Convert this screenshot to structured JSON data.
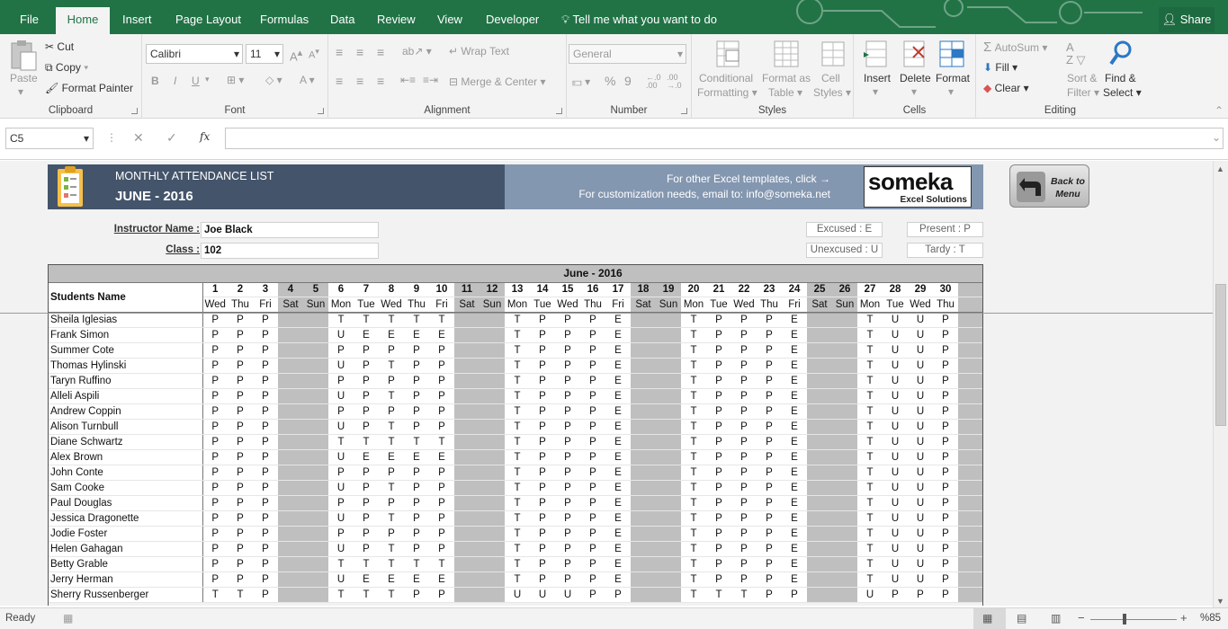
{
  "tabs": [
    {
      "label": "File"
    },
    {
      "label": "Home"
    },
    {
      "label": "Insert"
    },
    {
      "label": "Page Layout"
    },
    {
      "label": "Formulas"
    },
    {
      "label": "Data"
    },
    {
      "label": "Review"
    },
    {
      "label": "View"
    },
    {
      "label": "Developer"
    }
  ],
  "tell_me": "Tell me what you want to do",
  "share": "Share",
  "ribbon": {
    "clipboard": {
      "paste": "Paste",
      "cut": "Cut",
      "copy": "Copy",
      "format_painter": "Format Painter",
      "label": "Clipboard"
    },
    "font": {
      "name": "Calibri",
      "size": "11",
      "label": "Font",
      "bold": "B",
      "italic": "I",
      "underline": "U",
      "font_color": "A"
    },
    "alignment": {
      "wrap": "Wrap Text",
      "merge": "Merge & Center",
      "label": "Alignment"
    },
    "number": {
      "format": "General",
      "percent": "%",
      "comma": "9",
      "label": "Number"
    },
    "styles": {
      "cond1": "Conditional",
      "cond2": "Formatting",
      "fmt1": "Format as",
      "fmt2": "Table",
      "cell1": "Cell",
      "cell2": "Styles",
      "label": "Styles"
    },
    "cells": {
      "insert": "Insert",
      "delete": "Delete",
      "format": "Format",
      "label": "Cells"
    },
    "editing": {
      "autosum": "AutoSum",
      "fill": "Fill",
      "clear": "Clear",
      "sort1": "Sort &",
      "sort2": "Filter",
      "find1": "Find &",
      "find2": "Select",
      "label": "Editing"
    }
  },
  "formula_bar": {
    "name_box": "C5",
    "fx": "fx",
    "content": ""
  },
  "sheet": {
    "header_title": "MONTHLY ATTENDANCE LIST",
    "header_month": "JUNE - 2016",
    "promo_line1": "For other Excel templates, click →",
    "promo_line2": "For customization needs, email to: info@someka.net",
    "logo_text": "someka",
    "logo_sub": "Excel Solutions",
    "back_button": "Back to Menu",
    "instructor_label": "Instructor Name :",
    "instructor_value": "Joe Black",
    "class_label": "Class :",
    "class_value": "102",
    "legend": {
      "excused": "Excused : E",
      "present": "Present : P",
      "unexcused": "Unexcused : U",
      "tardy": "Tardy : T"
    },
    "table_title": "June - 2016",
    "students_header": "Students Name",
    "days": [
      "1",
      "2",
      "3",
      "4",
      "5",
      "6",
      "7",
      "8",
      "9",
      "10",
      "11",
      "12",
      "13",
      "14",
      "15",
      "16",
      "17",
      "18",
      "19",
      "20",
      "21",
      "22",
      "23",
      "24",
      "25",
      "26",
      "27",
      "28",
      "29",
      "30"
    ],
    "weekdays": [
      "Wed",
      "Thu",
      "Fri",
      "Sat",
      "Sun",
      "Mon",
      "Tue",
      "Wed",
      "Thu",
      "Fri",
      "Sat",
      "Sun",
      "Mon",
      "Tue",
      "Wed",
      "Thu",
      "Fri",
      "Sat",
      "Sun",
      "Mon",
      "Tue",
      "Wed",
      "Thu",
      "Fri",
      "Sat",
      "Sun",
      "Mon",
      "Tue",
      "Wed",
      "Thu"
    ],
    "weekend_cols": [
      4,
      5,
      11,
      12,
      18,
      19,
      25,
      26
    ],
    "students": [
      {
        "name": "Sheila Iglesias",
        "marks": [
          "P",
          "P",
          "P",
          "",
          "",
          "T",
          "T",
          "T",
          "T",
          "T",
          "",
          "",
          "T",
          "P",
          "P",
          "P",
          "E",
          "",
          "",
          "T",
          "P",
          "P",
          "P",
          "E",
          "",
          "",
          "T",
          "U",
          "U",
          "P"
        ]
      },
      {
        "name": "Frank Simon",
        "marks": [
          "P",
          "P",
          "P",
          "",
          "",
          "U",
          "E",
          "E",
          "E",
          "E",
          "",
          "",
          "T",
          "P",
          "P",
          "P",
          "E",
          "",
          "",
          "T",
          "P",
          "P",
          "P",
          "E",
          "",
          "",
          "T",
          "U",
          "U",
          "P"
        ]
      },
      {
        "name": "Summer Cote",
        "marks": [
          "P",
          "P",
          "P",
          "",
          "",
          "P",
          "P",
          "P",
          "P",
          "P",
          "",
          "",
          "T",
          "P",
          "P",
          "P",
          "E",
          "",
          "",
          "T",
          "P",
          "P",
          "P",
          "E",
          "",
          "",
          "T",
          "U",
          "U",
          "P"
        ]
      },
      {
        "name": "Thomas Hylinski",
        "marks": [
          "P",
          "P",
          "P",
          "",
          "",
          "U",
          "P",
          "T",
          "P",
          "P",
          "",
          "",
          "T",
          "P",
          "P",
          "P",
          "E",
          "",
          "",
          "T",
          "P",
          "P",
          "P",
          "E",
          "",
          "",
          "T",
          "U",
          "U",
          "P"
        ]
      },
      {
        "name": "Taryn Ruffino",
        "marks": [
          "P",
          "P",
          "P",
          "",
          "",
          "P",
          "P",
          "P",
          "P",
          "P",
          "",
          "",
          "T",
          "P",
          "P",
          "P",
          "E",
          "",
          "",
          "T",
          "P",
          "P",
          "P",
          "E",
          "",
          "",
          "T",
          "U",
          "U",
          "P"
        ]
      },
      {
        "name": "Alleli Aspili",
        "marks": [
          "P",
          "P",
          "P",
          "",
          "",
          "U",
          "P",
          "T",
          "P",
          "P",
          "",
          "",
          "T",
          "P",
          "P",
          "P",
          "E",
          "",
          "",
          "T",
          "P",
          "P",
          "P",
          "E",
          "",
          "",
          "T",
          "U",
          "U",
          "P"
        ]
      },
      {
        "name": "Andrew Coppin",
        "marks": [
          "P",
          "P",
          "P",
          "",
          "",
          "P",
          "P",
          "P",
          "P",
          "P",
          "",
          "",
          "T",
          "P",
          "P",
          "P",
          "E",
          "",
          "",
          "T",
          "P",
          "P",
          "P",
          "E",
          "",
          "",
          "T",
          "U",
          "U",
          "P"
        ]
      },
      {
        "name": "Alison Turnbull",
        "marks": [
          "P",
          "P",
          "P",
          "",
          "",
          "U",
          "P",
          "T",
          "P",
          "P",
          "",
          "",
          "T",
          "P",
          "P",
          "P",
          "E",
          "",
          "",
          "T",
          "P",
          "P",
          "P",
          "E",
          "",
          "",
          "T",
          "U",
          "U",
          "P"
        ]
      },
      {
        "name": "Diane Schwartz",
        "marks": [
          "P",
          "P",
          "P",
          "",
          "",
          "T",
          "T",
          "T",
          "T",
          "T",
          "",
          "",
          "T",
          "P",
          "P",
          "P",
          "E",
          "",
          "",
          "T",
          "P",
          "P",
          "P",
          "E",
          "",
          "",
          "T",
          "U",
          "U",
          "P"
        ]
      },
      {
        "name": "Alex Brown",
        "marks": [
          "P",
          "P",
          "P",
          "",
          "",
          "U",
          "E",
          "E",
          "E",
          "E",
          "",
          "",
          "T",
          "P",
          "P",
          "P",
          "E",
          "",
          "",
          "T",
          "P",
          "P",
          "P",
          "E",
          "",
          "",
          "T",
          "U",
          "U",
          "P"
        ]
      },
      {
        "name": "John Conte",
        "marks": [
          "P",
          "P",
          "P",
          "",
          "",
          "P",
          "P",
          "P",
          "P",
          "P",
          "",
          "",
          "T",
          "P",
          "P",
          "P",
          "E",
          "",
          "",
          "T",
          "P",
          "P",
          "P",
          "E",
          "",
          "",
          "T",
          "U",
          "U",
          "P"
        ]
      },
      {
        "name": "Sam Cooke",
        "marks": [
          "P",
          "P",
          "P",
          "",
          "",
          "U",
          "P",
          "T",
          "P",
          "P",
          "",
          "",
          "T",
          "P",
          "P",
          "P",
          "E",
          "",
          "",
          "T",
          "P",
          "P",
          "P",
          "E",
          "",
          "",
          "T",
          "U",
          "U",
          "P"
        ]
      },
      {
        "name": "Paul Douglas",
        "marks": [
          "P",
          "P",
          "P",
          "",
          "",
          "P",
          "P",
          "P",
          "P",
          "P",
          "",
          "",
          "T",
          "P",
          "P",
          "P",
          "E",
          "",
          "",
          "T",
          "P",
          "P",
          "P",
          "E",
          "",
          "",
          "T",
          "U",
          "U",
          "P"
        ]
      },
      {
        "name": "Jessica Dragonette",
        "marks": [
          "P",
          "P",
          "P",
          "",
          "",
          "U",
          "P",
          "T",
          "P",
          "P",
          "",
          "",
          "T",
          "P",
          "P",
          "P",
          "E",
          "",
          "",
          "T",
          "P",
          "P",
          "P",
          "E",
          "",
          "",
          "T",
          "U",
          "U",
          "P"
        ]
      },
      {
        "name": "Jodie Foster",
        "marks": [
          "P",
          "P",
          "P",
          "",
          "",
          "P",
          "P",
          "P",
          "P",
          "P",
          "",
          "",
          "T",
          "P",
          "P",
          "P",
          "E",
          "",
          "",
          "T",
          "P",
          "P",
          "P",
          "E",
          "",
          "",
          "T",
          "U",
          "U",
          "P"
        ]
      },
      {
        "name": "Helen Gahagan",
        "marks": [
          "P",
          "P",
          "P",
          "",
          "",
          "U",
          "P",
          "T",
          "P",
          "P",
          "",
          "",
          "T",
          "P",
          "P",
          "P",
          "E",
          "",
          "",
          "T",
          "P",
          "P",
          "P",
          "E",
          "",
          "",
          "T",
          "U",
          "U",
          "P"
        ]
      },
      {
        "name": "Betty Grable",
        "marks": [
          "P",
          "P",
          "P",
          "",
          "",
          "T",
          "T",
          "T",
          "T",
          "T",
          "",
          "",
          "T",
          "P",
          "P",
          "P",
          "E",
          "",
          "",
          "T",
          "P",
          "P",
          "P",
          "E",
          "",
          "",
          "T",
          "U",
          "U",
          "P"
        ]
      },
      {
        "name": "Jerry Herman",
        "marks": [
          "P",
          "P",
          "P",
          "",
          "",
          "U",
          "E",
          "E",
          "E",
          "E",
          "",
          "",
          "T",
          "P",
          "P",
          "P",
          "E",
          "",
          "",
          "T",
          "P",
          "P",
          "P",
          "E",
          "",
          "",
          "T",
          "U",
          "U",
          "P"
        ]
      },
      {
        "name": "Sherry Russenberger",
        "marks": [
          "T",
          "T",
          "P",
          "",
          "",
          "T",
          "T",
          "T",
          "P",
          "P",
          "",
          "",
          "U",
          "U",
          "U",
          "P",
          "P",
          "",
          "",
          "T",
          "T",
          "T",
          "P",
          "P",
          "",
          "",
          "U",
          "P",
          "P",
          "P"
        ]
      }
    ]
  },
  "status": {
    "ready": "Ready",
    "zoom": "%85",
    "minus": "−",
    "plus": "+"
  }
}
